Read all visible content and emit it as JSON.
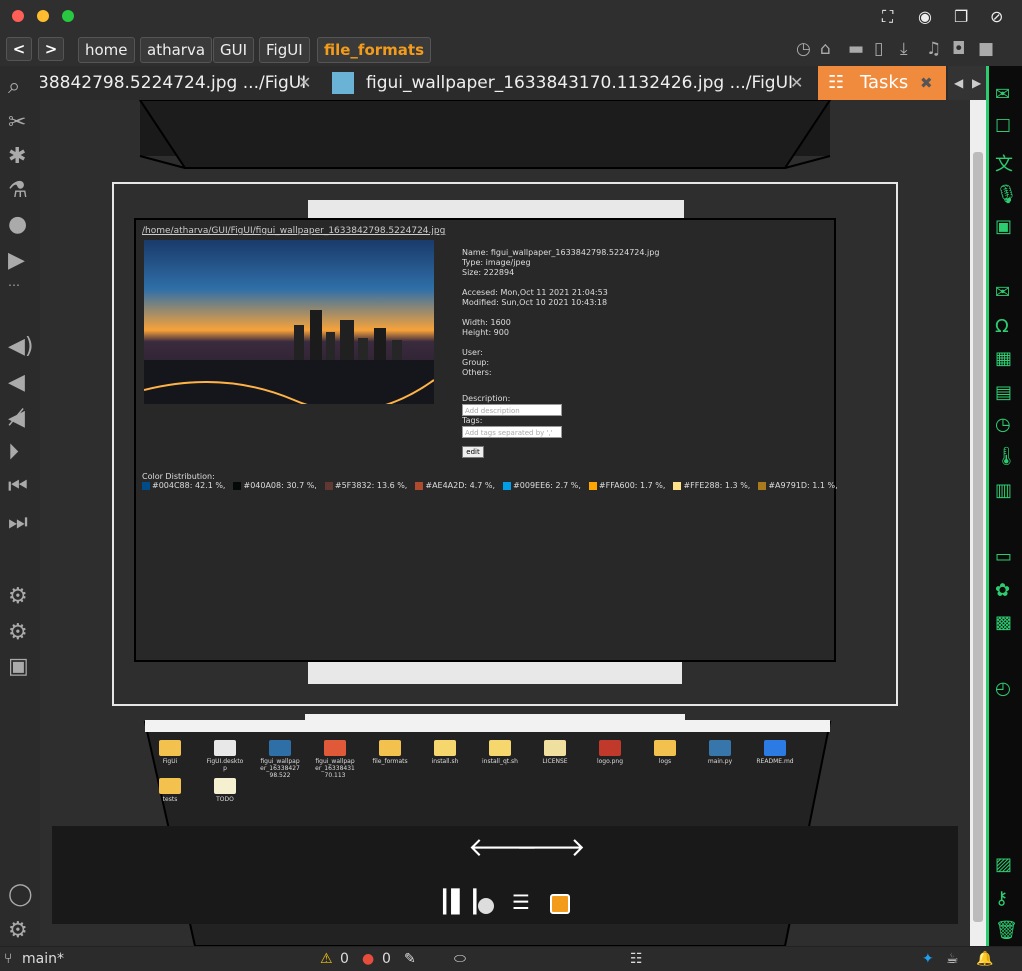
{
  "window": {
    "controls": [
      "close",
      "minimize",
      "maximize"
    ],
    "colors": {
      "close": "#ff5f57",
      "minimize": "#febc2e",
      "maximize": "#28c840"
    },
    "top_right_icons": [
      "fullscreen-icon",
      "eye-icon",
      "restore-icon",
      "eye-off-icon"
    ]
  },
  "navbar": {
    "back": "<",
    "forward": ">",
    "breadcrumbs": [
      "home",
      "atharva",
      "GUI",
      "FigUI",
      "file_formats"
    ],
    "icons": [
      "history-icon",
      "home-icon",
      "folder-icon",
      "file-icon",
      "download-icon",
      "music-icon",
      "camera-icon",
      "video-icon"
    ]
  },
  "tabs": [
    {
      "label": "38842798.5224724.jpg .../FigUI",
      "close": "✕"
    },
    {
      "label": "figui_wallpaper_1633843170.1132426.jpg .../FigUI",
      "close": "✕"
    }
  ],
  "tasks_tab": {
    "label": "Tasks",
    "close": "✖"
  },
  "preview": {
    "path": "/home/atharva/GUI/FigUI/figui_wallpaper_1633842798.5224724.jpg",
    "info": {
      "name": "Name: figui_wallpaper_1633842798.5224724.jpg",
      "type": "Type: image/jpeg",
      "size": "Size: 222894",
      "accessed": "Accesed: Mon,Oct 11 2021 21:04:53",
      "modified": "Modified: Sun,Oct 10 2021 10:43:18",
      "width": "Width: 1600",
      "height": "Height: 900",
      "user": "User:",
      "group": "Group:",
      "others": "Others:",
      "description_label": "Description:",
      "description_placeholder": "Add description",
      "tags_label": "Tags:",
      "tags_placeholder": "Add tags separated by ','",
      "edit": "edit"
    },
    "color_distribution_label": "Color Distribution:",
    "colors": [
      {
        "hex": "#004C88",
        "text": "#004C88: 42.1 %,"
      },
      {
        "hex": "#040A08",
        "text": "#040A08: 30.7 %,"
      },
      {
        "hex": "#5F3832",
        "text": "#5F3832: 13.6 %,"
      },
      {
        "hex": "#AE4A2D",
        "text": "#AE4A2D: 4.7 %,"
      },
      {
        "hex": "#009EE6",
        "text": "#009EE6: 2.7 %,"
      },
      {
        "hex": "#FFA600",
        "text": "#FFA600: 1.7 %,"
      },
      {
        "hex": "#FFE288",
        "text": "#FFE288: 1.3 %,"
      },
      {
        "hex": "#A9791D",
        "text": "#A9791D: 1.1 %,"
      }
    ]
  },
  "file_browser": {
    "items": [
      {
        "label": "FigUi",
        "color": "#f2c14e"
      },
      {
        "label": "FigUI.desktop",
        "color": "#e8e8e8"
      },
      {
        "label": "figui_wallpaper_1633842798.522",
        "color": "#2f6fa8"
      },
      {
        "label": "figui_wallpaper_1633843170.113",
        "color": "#e05a3a"
      },
      {
        "label": "file_formats",
        "color": "#f2c14e"
      },
      {
        "label": "install.sh",
        "color": "#f5d76e"
      },
      {
        "label": "install_qt.sh",
        "color": "#f5d76e"
      },
      {
        "label": "LICENSE",
        "color": "#f0e0a0"
      },
      {
        "label": "logo.png",
        "color": "#c0392b"
      },
      {
        "label": "logs",
        "color": "#f2c14e"
      },
      {
        "label": "main.py",
        "color": "#3776ab"
      },
      {
        "label": "README.md",
        "color": "#2c7be5"
      },
      {
        "label": "tests",
        "color": "#f2c14e"
      },
      {
        "label": "TODO",
        "color": "#f5f0d0"
      }
    ]
  },
  "overlay_controls": {
    "prev": "🡐",
    "next": "🡒",
    "icons": [
      "fit-width-icon",
      "circle-icon",
      "fit-height-icon",
      "capture-icon"
    ]
  },
  "status": {
    "branch": "main*",
    "warnings": "0",
    "errors": "0"
  }
}
